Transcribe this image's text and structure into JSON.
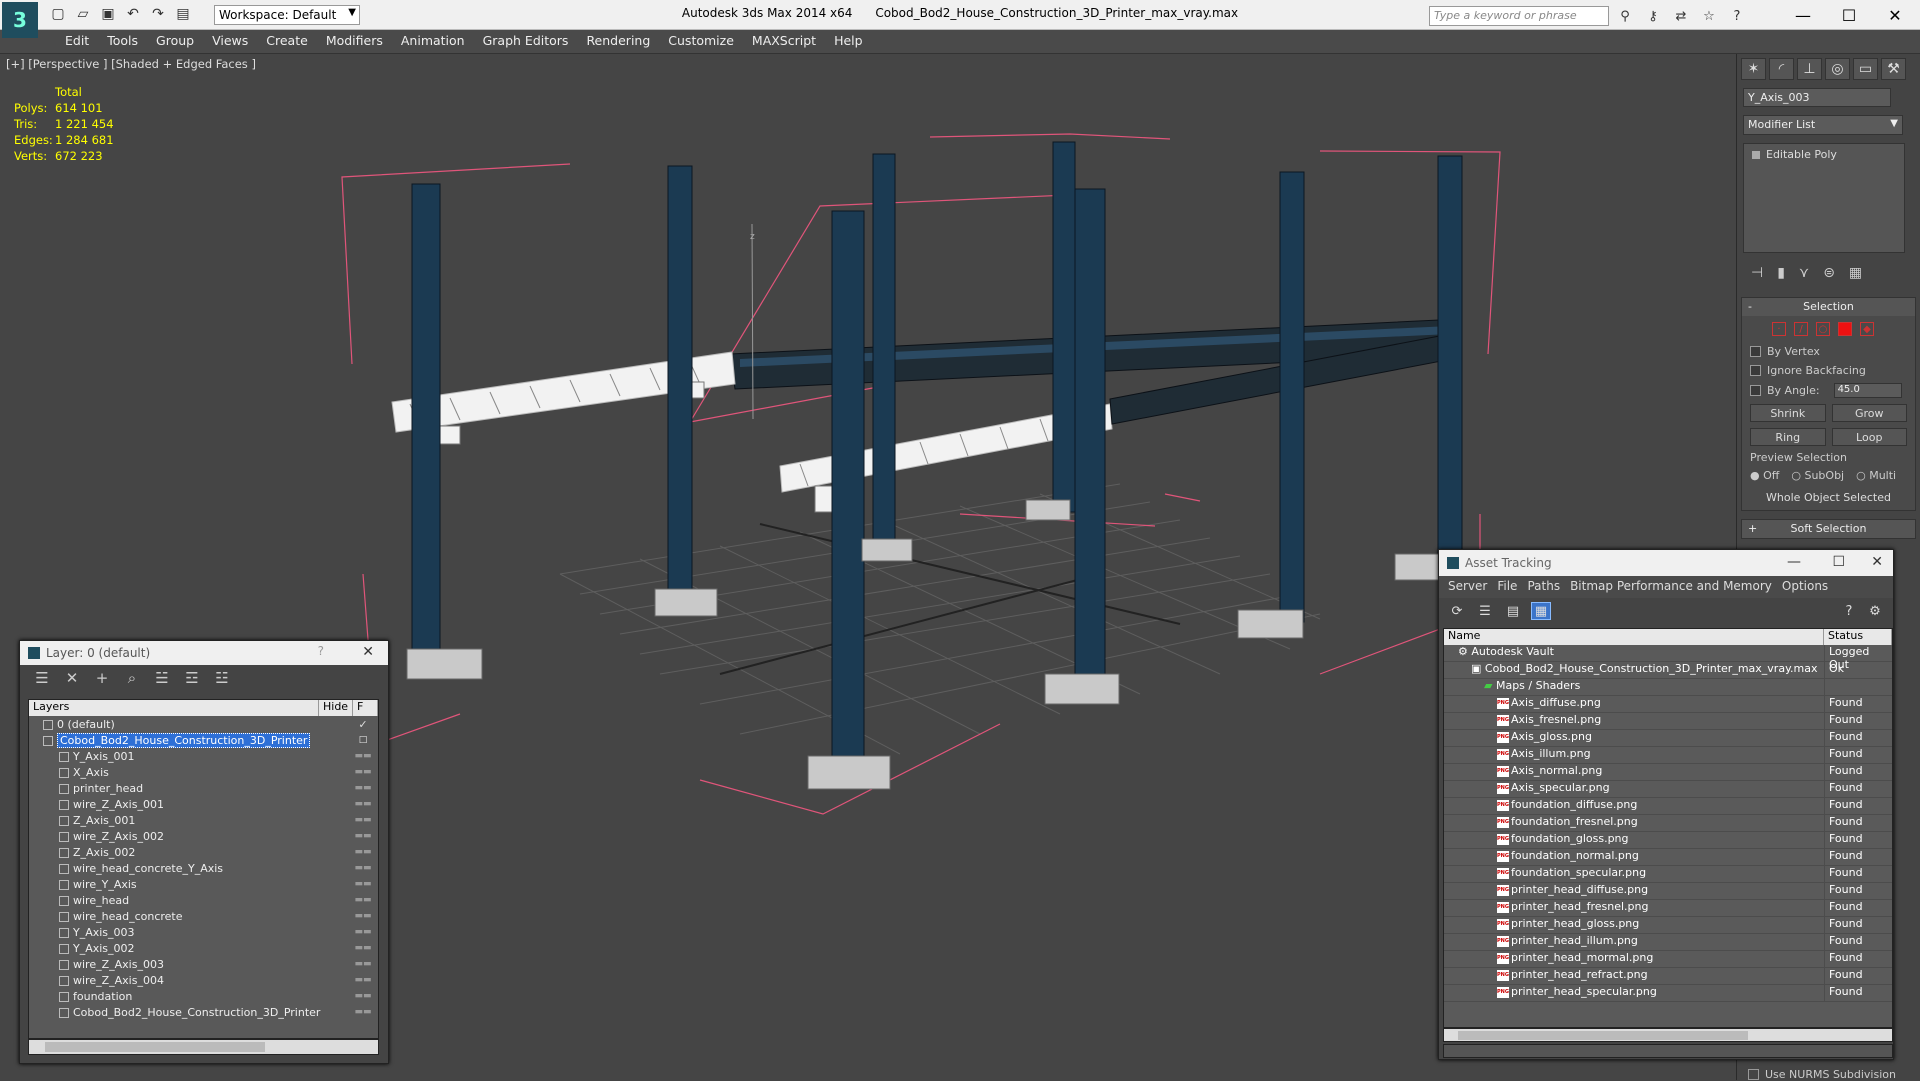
{
  "titlebar": {
    "workspace": "Workspace: Default",
    "app_title": "Autodesk 3ds Max 2014 x64",
    "file_title": "Cobod_Bod2_House_Construction_3D_Printer_max_vray.max",
    "search_placeholder": "Type a keyword or phrase",
    "icons": [
      "binoculars-icon",
      "key-icon",
      "exchange-icon",
      "star-icon",
      "help-icon"
    ]
  },
  "menu": [
    "Edit",
    "Tools",
    "Group",
    "Views",
    "Create",
    "Modifiers",
    "Animation",
    "Graph Editors",
    "Rendering",
    "Customize",
    "MAXScript",
    "Help"
  ],
  "viewport": {
    "label": "[+] [Perspective ] [Shaded + Edged Faces ]",
    "stats": {
      "header": "Total",
      "rows": [
        {
          "k": "Polys:",
          "v": "614 101"
        },
        {
          "k": "Tris:",
          "v": "1 221 454"
        },
        {
          "k": "Edges:",
          "v": "1 284 681"
        },
        {
          "k": "Verts:",
          "v": "672 223"
        }
      ]
    },
    "axis_label": "z"
  },
  "command_panel": {
    "object_name": "Y_Axis_003",
    "modifier_list": "Modifier List",
    "stack_item": "Editable Poly",
    "selection": {
      "title": "Selection",
      "by_vertex": "By Vertex",
      "ignore_backfacing": "Ignore Backfacing",
      "by_angle": "By Angle:",
      "angle_value": "45.0",
      "shrink": "Shrink",
      "grow": "Grow",
      "ring": "Ring",
      "loop": "Loop",
      "preview_selection": "Preview Selection",
      "radio_off": "Off",
      "radio_subobj": "SubObj",
      "radio_multi": "Multi",
      "status": "Whole Object Selected"
    },
    "soft_selection": "Soft Selection",
    "nurms": "Use NURMS Subdivision"
  },
  "layer_window": {
    "title": "Layer: 0 (default)",
    "help": "?",
    "col_layers": "Layers",
    "col_hide": "Hide",
    "col_f": "F",
    "rows": [
      {
        "name": "0 (default)",
        "level": 0,
        "sel": false
      },
      {
        "name": "Cobod_Bod2_House_Construction_3D_Printer",
        "level": 0,
        "sel": true
      },
      {
        "name": "Y_Axis_001",
        "level": 1,
        "sel": false
      },
      {
        "name": "X_Axis",
        "level": 1,
        "sel": false
      },
      {
        "name": "printer_head",
        "level": 1,
        "sel": false
      },
      {
        "name": "wire_Z_Axis_001",
        "level": 1,
        "sel": false
      },
      {
        "name": "Z_Axis_001",
        "level": 1,
        "sel": false
      },
      {
        "name": "wire_Z_Axis_002",
        "level": 1,
        "sel": false
      },
      {
        "name": "Z_Axis_002",
        "level": 1,
        "sel": false
      },
      {
        "name": "wire_head_concrete_Y_Axis",
        "level": 1,
        "sel": false
      },
      {
        "name": "wire_Y_Axis",
        "level": 1,
        "sel": false
      },
      {
        "name": "wire_head",
        "level": 1,
        "sel": false
      },
      {
        "name": "wire_head_concrete",
        "level": 1,
        "sel": false
      },
      {
        "name": "Y_Axis_003",
        "level": 1,
        "sel": false
      },
      {
        "name": "Y_Axis_002",
        "level": 1,
        "sel": false
      },
      {
        "name": "wire_Z_Axis_003",
        "level": 1,
        "sel": false
      },
      {
        "name": "wire_Z_Axis_004",
        "level": 1,
        "sel": false
      },
      {
        "name": "foundation",
        "level": 1,
        "sel": false
      },
      {
        "name": "Cobod_Bod2_House_Construction_3D_Printer",
        "level": 1,
        "sel": false
      }
    ]
  },
  "asset_window": {
    "title": "Asset Tracking",
    "menu": [
      "Server",
      "File",
      "Paths",
      "Bitmap Performance and Memory",
      "Options"
    ],
    "col_name": "Name",
    "col_status": "Status",
    "rows": [
      {
        "name": "Autodesk Vault",
        "status": "Logged Out",
        "level": 0,
        "type": "vault"
      },
      {
        "name": "Cobod_Bod2_House_Construction_3D_Printer_max_vray.max",
        "status": "Ok",
        "level": 1,
        "type": "max"
      },
      {
        "name": "Maps / Shaders",
        "status": "",
        "level": 2,
        "type": "maps"
      },
      {
        "name": "Axis_diffuse.png",
        "status": "Found",
        "level": 3,
        "type": "png"
      },
      {
        "name": "Axis_fresnel.png",
        "status": "Found",
        "level": 3,
        "type": "png"
      },
      {
        "name": "Axis_gloss.png",
        "status": "Found",
        "level": 3,
        "type": "png"
      },
      {
        "name": "Axis_illum.png",
        "status": "Found",
        "level": 3,
        "type": "png"
      },
      {
        "name": "Axis_normal.png",
        "status": "Found",
        "level": 3,
        "type": "png"
      },
      {
        "name": "Axis_specular.png",
        "status": "Found",
        "level": 3,
        "type": "png"
      },
      {
        "name": "foundation_diffuse.png",
        "status": "Found",
        "level": 3,
        "type": "png"
      },
      {
        "name": "foundation_fresnel.png",
        "status": "Found",
        "level": 3,
        "type": "png"
      },
      {
        "name": "foundation_gloss.png",
        "status": "Found",
        "level": 3,
        "type": "png"
      },
      {
        "name": "foundation_normal.png",
        "status": "Found",
        "level": 3,
        "type": "png"
      },
      {
        "name": "foundation_specular.png",
        "status": "Found",
        "level": 3,
        "type": "png"
      },
      {
        "name": "printer_head_diffuse.png",
        "status": "Found",
        "level": 3,
        "type": "png"
      },
      {
        "name": "printer_head_fresnel.png",
        "status": "Found",
        "level": 3,
        "type": "png"
      },
      {
        "name": "printer_head_gloss.png",
        "status": "Found",
        "level": 3,
        "type": "png"
      },
      {
        "name": "printer_head_illum.png",
        "status": "Found",
        "level": 3,
        "type": "png"
      },
      {
        "name": "printer_head_mormal.png",
        "status": "Found",
        "level": 3,
        "type": "png"
      },
      {
        "name": "printer_head_refract.png",
        "status": "Found",
        "level": 3,
        "type": "png"
      },
      {
        "name": "printer_head_specular.png",
        "status": "Found",
        "level": 3,
        "type": "png"
      }
    ]
  },
  "colors": {
    "accent": "#2d6fd6",
    "stats": "#ffff00",
    "bbox": "#e0557a",
    "frame": "#1b3a52"
  }
}
